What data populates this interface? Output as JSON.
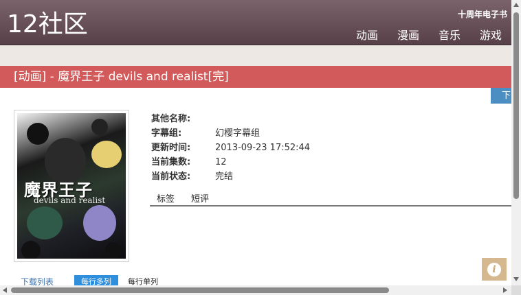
{
  "header": {
    "logo": "12社区",
    "ebook_link": "十周年电子书",
    "nav": [
      "动画",
      "漫画",
      "音乐",
      "游戏"
    ]
  },
  "title": "[动画] - 魔界王子 devils and realist[完]",
  "download_tab": "下",
  "poster": {
    "title": "魔界王子",
    "subtitle": "devils and realist"
  },
  "info": [
    {
      "label": "其他名称:",
      "value": ""
    },
    {
      "label": "字幕组:",
      "value": "幻樱字幕组"
    },
    {
      "label": "更新时间:",
      "value": "2013-09-23 17:52:44"
    },
    {
      "label": "当前集数:",
      "value": "12"
    },
    {
      "label": "当前状态:",
      "value": "完结"
    }
  ],
  "tabs": [
    "标签",
    "短评"
  ],
  "download_list": {
    "label": "下载列表",
    "view_multi": "每行多列",
    "view_single": "每行单列"
  },
  "info_icon": "info-icon",
  "colors": {
    "header": "#5e474e",
    "title_bar": "#d25a5a",
    "download_tab": "#4a8ec2",
    "view_multi": "#2f8fdc",
    "info_button": "#d5b890"
  }
}
